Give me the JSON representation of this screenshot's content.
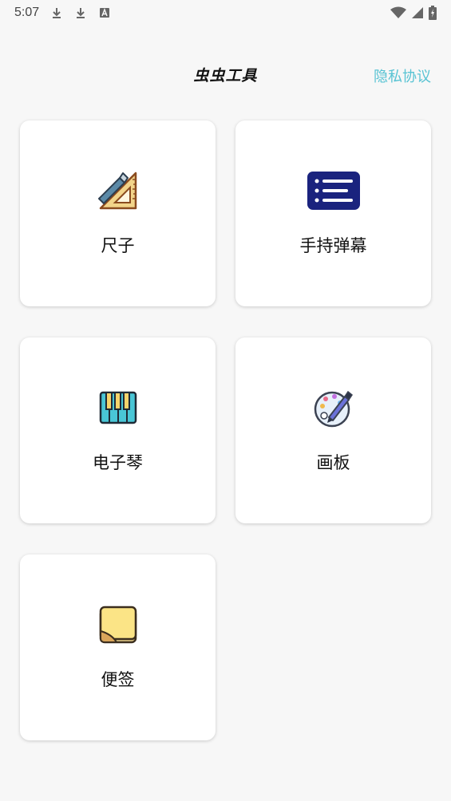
{
  "status_bar": {
    "time": "5:07",
    "icons": [
      "download-icon",
      "download-icon",
      "a-box-icon",
      "wifi-icon",
      "signal-icon",
      "battery-charging-icon"
    ]
  },
  "header": {
    "title": "虫虫工具",
    "privacy_link": "隐私协议",
    "accent_color": "#58c3d3"
  },
  "tiles": [
    {
      "label": "尺子",
      "icon": "ruler-icon"
    },
    {
      "label": "手持弹幕",
      "icon": "danmaku-icon"
    },
    {
      "label": "电子琴",
      "icon": "piano-icon"
    },
    {
      "label": "画板",
      "icon": "palette-icon"
    },
    {
      "label": "便签",
      "icon": "sticky-note-icon"
    }
  ]
}
